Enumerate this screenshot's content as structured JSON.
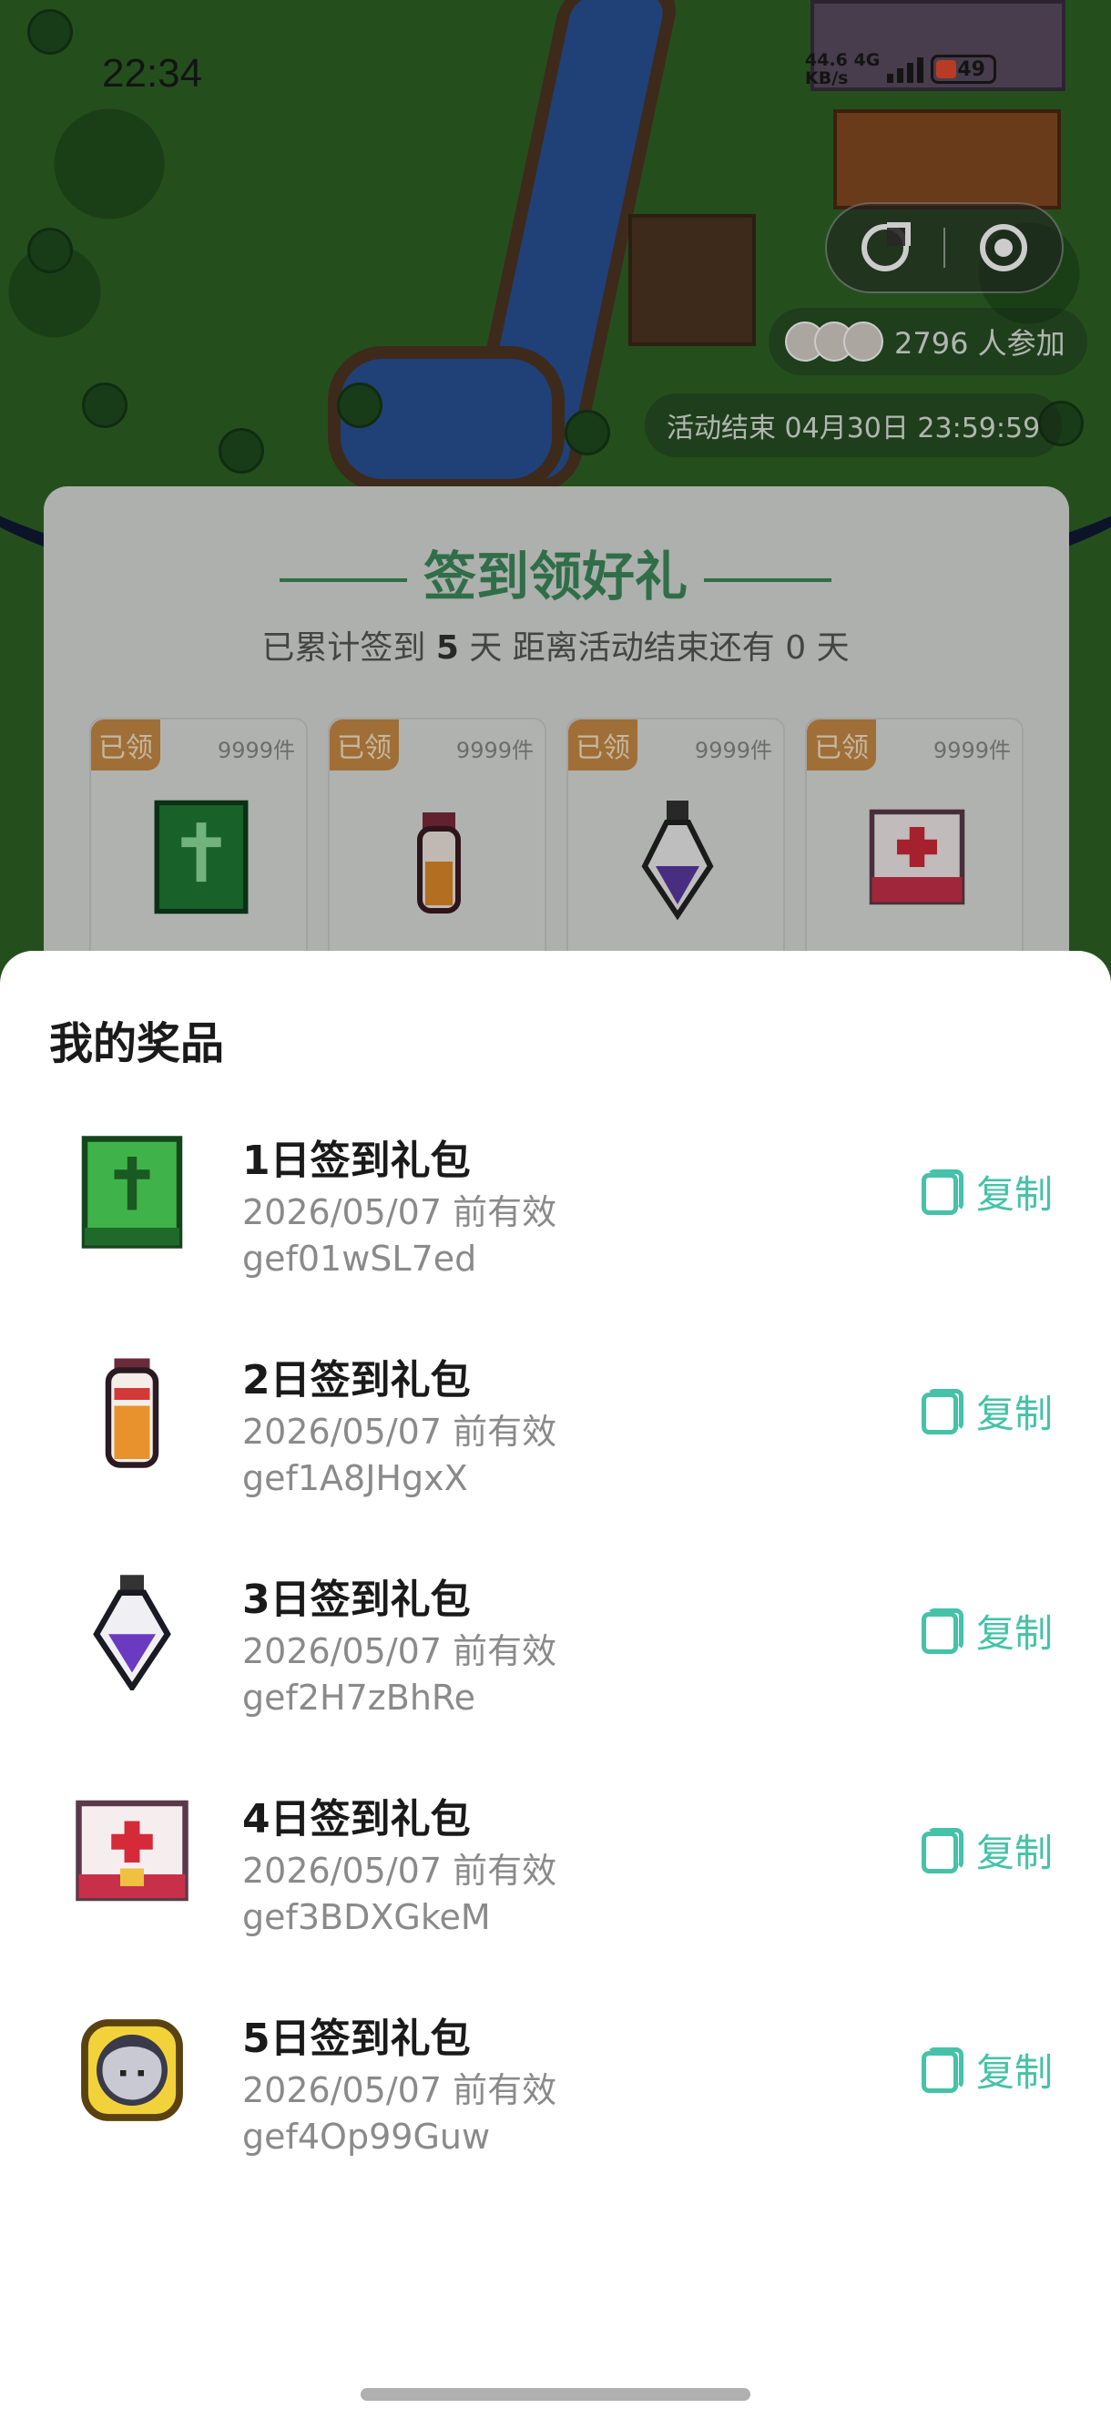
{
  "status_bar": {
    "time": "22:34",
    "net_speed": "44.6",
    "net_unit": "KB/s",
    "net_type": "4G",
    "battery": "49"
  },
  "scene": {
    "participants": "2796 人参加",
    "end_time": "活动结束 04月30日 23:59:59"
  },
  "signin_card": {
    "title": "签到领好礼",
    "subtitle_prefix": "已累计签到",
    "days": "5",
    "subtitle_suffix": "天  距离活动结束还有 0 天",
    "rewards": [
      {
        "tag": "已领",
        "count": "9999件",
        "icon": "green-book-icon"
      },
      {
        "tag": "已领",
        "count": "9999件",
        "icon": "potion-vial-icon"
      },
      {
        "tag": "已领",
        "count": "9999件",
        "icon": "purple-potion-icon"
      },
      {
        "tag": "已领",
        "count": "9999件",
        "icon": "medkit-icon"
      }
    ]
  },
  "sheet": {
    "title": "我的奖品",
    "copy_label": "复制",
    "prizes": [
      {
        "name": "1日签到礼包",
        "valid": "2026/05/07 前有效",
        "code": "gef01wSL7ed",
        "icon": "green-book-icon"
      },
      {
        "name": "2日签到礼包",
        "valid": "2026/05/07 前有效",
        "code": "gef1A8JHgxX",
        "icon": "potion-vial-icon"
      },
      {
        "name": "3日签到礼包",
        "valid": "2026/05/07 前有效",
        "code": "gef2H7zBhRe",
        "icon": "purple-potion-icon"
      },
      {
        "name": "4日签到礼包",
        "valid": "2026/05/07 前有效",
        "code": "gef3BDXGkeM",
        "icon": "medkit-icon"
      },
      {
        "name": "5日签到礼包",
        "valid": "2026/05/07 前有效",
        "code": "gef4Op99Guw",
        "icon": "avatar-badge-icon"
      }
    ]
  },
  "colors": {
    "accent": "#45c2a8",
    "title_green": "#3b8a5a",
    "tag_orange": "#c98a45"
  }
}
